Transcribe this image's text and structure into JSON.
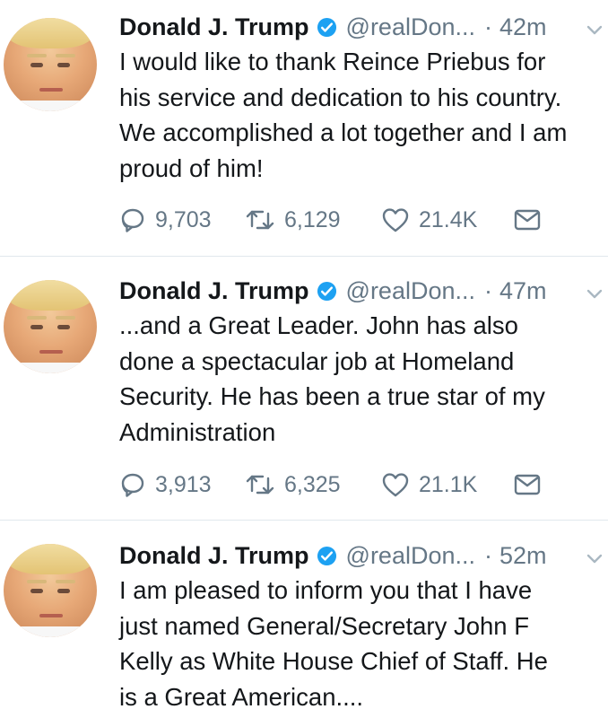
{
  "tweets": [
    {
      "name": "Donald J. Trump",
      "handle": "@realDon...",
      "dot": "·",
      "time": "42m",
      "text": "I would like to thank Reince Priebus for\nhis service and dedication to his country.\nWe accomplished a lot together and I am\nproud of him!",
      "replies": "9,703",
      "retweets": "6,129",
      "likes": "21.4K"
    },
    {
      "name": "Donald J. Trump",
      "handle": "@realDon...",
      "dot": "·",
      "time": "47m",
      "text": "...and a Great Leader. John has also\ndone a spectacular job at Homeland\nSecurity. He has been a true star of my\nAdministration",
      "replies": "3,913",
      "retweets": "6,325",
      "likes": "21.1K"
    },
    {
      "name": "Donald J. Trump",
      "handle": "@realDon...",
      "dot": "·",
      "time": "52m",
      "text": "I am pleased to inform you that I have\njust named General/Secretary John F\nKelly as White House Chief of Staff. He\nis a Great American....",
      "replies": "",
      "retweets": "",
      "likes": ""
    }
  ],
  "icons": {
    "verified": "verified-badge-icon",
    "caret": "chevron-down-icon",
    "reply": "reply-bubble-icon",
    "retweet": "retweet-icon",
    "like": "heart-icon",
    "dm": "envelope-icon"
  },
  "colors": {
    "text": "#14171a",
    "muted": "#657786",
    "verified": "#1da1f2",
    "divider": "#e1e8ed"
  }
}
